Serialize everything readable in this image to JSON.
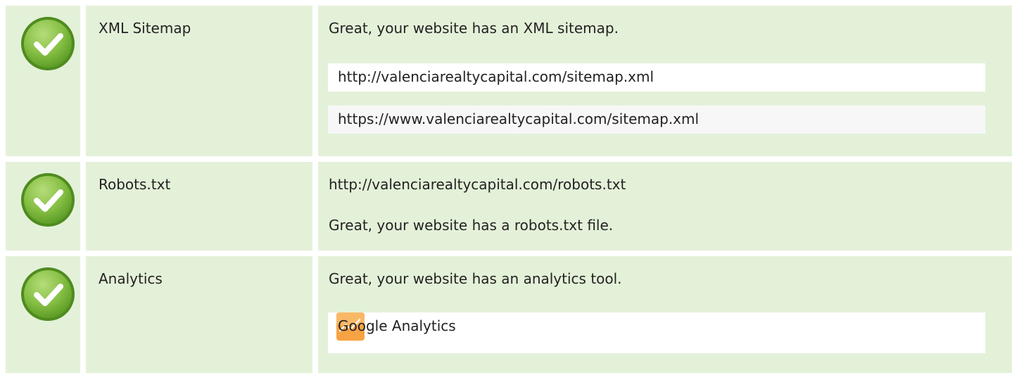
{
  "rows": [
    {
      "status": "pass",
      "name": "XML Sitemap",
      "message": "Great, your website has an XML sitemap.",
      "sitemaps": [
        "http://valenciarealtycapital.com/sitemap.xml",
        "https://www.valenciarealtycapital.com/sitemap.xml"
      ]
    },
    {
      "status": "pass",
      "name": "Robots.txt",
      "url": "http://valenciarealtycapital.com/robots.txt",
      "message": "Great, your website has a robots.txt file."
    },
    {
      "status": "pass",
      "name": "Analytics",
      "message": "Great, your website has an analytics tool.",
      "tools": [
        {
          "icon": "google-analytics-icon",
          "label": "Google Analytics"
        }
      ]
    }
  ],
  "colors": {
    "row_bg": "#e4f1d9",
    "check_green": "#7ab53b",
    "check_ring": "#5a9a26",
    "ga_orange": "#f7a344"
  }
}
